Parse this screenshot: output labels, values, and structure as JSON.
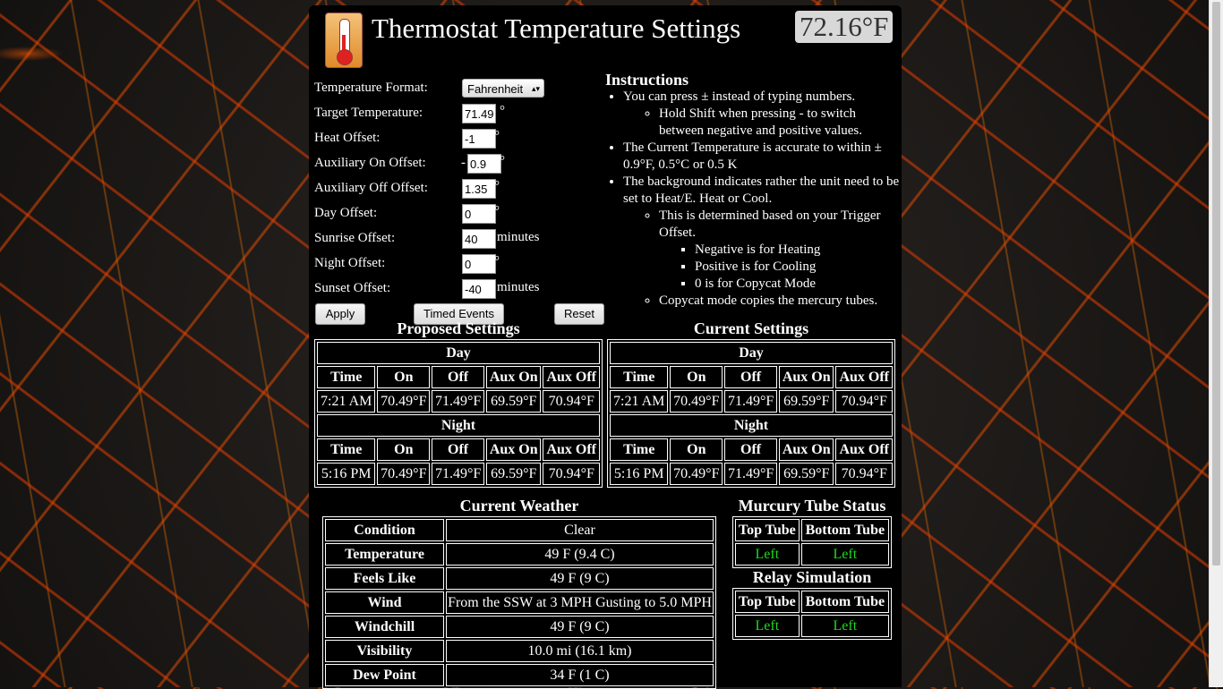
{
  "header": {
    "title": "Thermostat Temperature Settings",
    "current_temp": "72.16°F",
    "icon": "thermometer-icon"
  },
  "form": {
    "format": {
      "label": "Temperature Format:",
      "value": "Fahrenheit"
    },
    "target": {
      "label": "Target Temperature:",
      "value": "71.49",
      "unit": "°"
    },
    "heat": {
      "label": "Heat Offset:",
      "value": "-1",
      "unit": "°"
    },
    "aux_on": {
      "label": "Auxiliary On Offset:",
      "prefix": "-",
      "value": "0.9",
      "unit": "°"
    },
    "aux_off": {
      "label": "Auxiliary Off Offset:",
      "value": "1.35",
      "unit": "°"
    },
    "day": {
      "label": "Day Offset:",
      "value": "0",
      "unit": "°"
    },
    "sunrise": {
      "label": "Sunrise Offset:",
      "value": "40",
      "unit": "minutes"
    },
    "night": {
      "label": "Night Offset:",
      "value": "0",
      "unit": "°"
    },
    "sunset": {
      "label": "Sunset Offset:",
      "value": "-40",
      "unit": "minutes"
    },
    "buttons": {
      "apply": "Apply",
      "timed": "Timed Events",
      "reset": "Reset"
    }
  },
  "instructions": {
    "title": "Instructions",
    "i1": "You can press ± instead of typing numbers.",
    "i1a": "Hold Shift when pressing - to switch between negative and positive values.",
    "i2": "The Current Temperature is accurate to within ± 0.9°F, 0.5°C or 0.5 K",
    "i3": "The background indicates rather the unit need to be set to Heat/E. Heat or Cool.",
    "i3a": "This is determined based on your Trigger Offset.",
    "i3a1": "Negative is for Heating",
    "i3a2": "Positive is for Cooling",
    "i3a3": "0 is for Copycat Mode",
    "i3b": "Copycat mode copies the mercury tubes."
  },
  "proposed": {
    "title": "Proposed Settings",
    "day_label": "Day",
    "night_label": "Night",
    "headers": [
      "Time",
      "On",
      "Off",
      "Aux On",
      "Aux Off"
    ],
    "day": [
      "7:21 AM",
      "70.49°F",
      "71.49°F",
      "69.59°F",
      "70.94°F"
    ],
    "night": [
      "5:16 PM",
      "70.49°F",
      "71.49°F",
      "69.59°F",
      "70.94°F"
    ]
  },
  "current": {
    "title": "Current Settings",
    "day_label": "Day",
    "night_label": "Night",
    "headers": [
      "Time",
      "On",
      "Off",
      "Aux On",
      "Aux Off"
    ],
    "day": [
      "7:21 AM",
      "70.49°F",
      "71.49°F",
      "69.59°F",
      "70.94°F"
    ],
    "night": [
      "5:16 PM",
      "70.49°F",
      "71.49°F",
      "69.59°F",
      "70.94°F"
    ]
  },
  "weather": {
    "title": "Current Weather",
    "rows": [
      [
        "Condition",
        "Clear"
      ],
      [
        "Temperature",
        "49 F (9.4 C)"
      ],
      [
        "Feels Like",
        "49 F (9 C)"
      ],
      [
        "Wind",
        "From the SSW at 3 MPH Gusting to 5.0 MPH"
      ],
      [
        "Windchill",
        "49 F (9 C)"
      ],
      [
        "Visibility",
        "10.0 mi (16.1 km)"
      ],
      [
        "Dew Point",
        "34 F (1 C)"
      ]
    ]
  },
  "tubes": {
    "title": "Murcury Tube Status",
    "top": "Top Tube",
    "bottom": "Bottom Tube",
    "top_val": "Left",
    "bottom_val": "Left"
  },
  "relay": {
    "title": "Relay Simulation",
    "top": "Top Tube",
    "bottom": "Bottom Tube",
    "top_val": "Left",
    "bottom_val": "Left"
  },
  "colors": {
    "status_green": "#1bdc1b",
    "panel": "#000000"
  }
}
